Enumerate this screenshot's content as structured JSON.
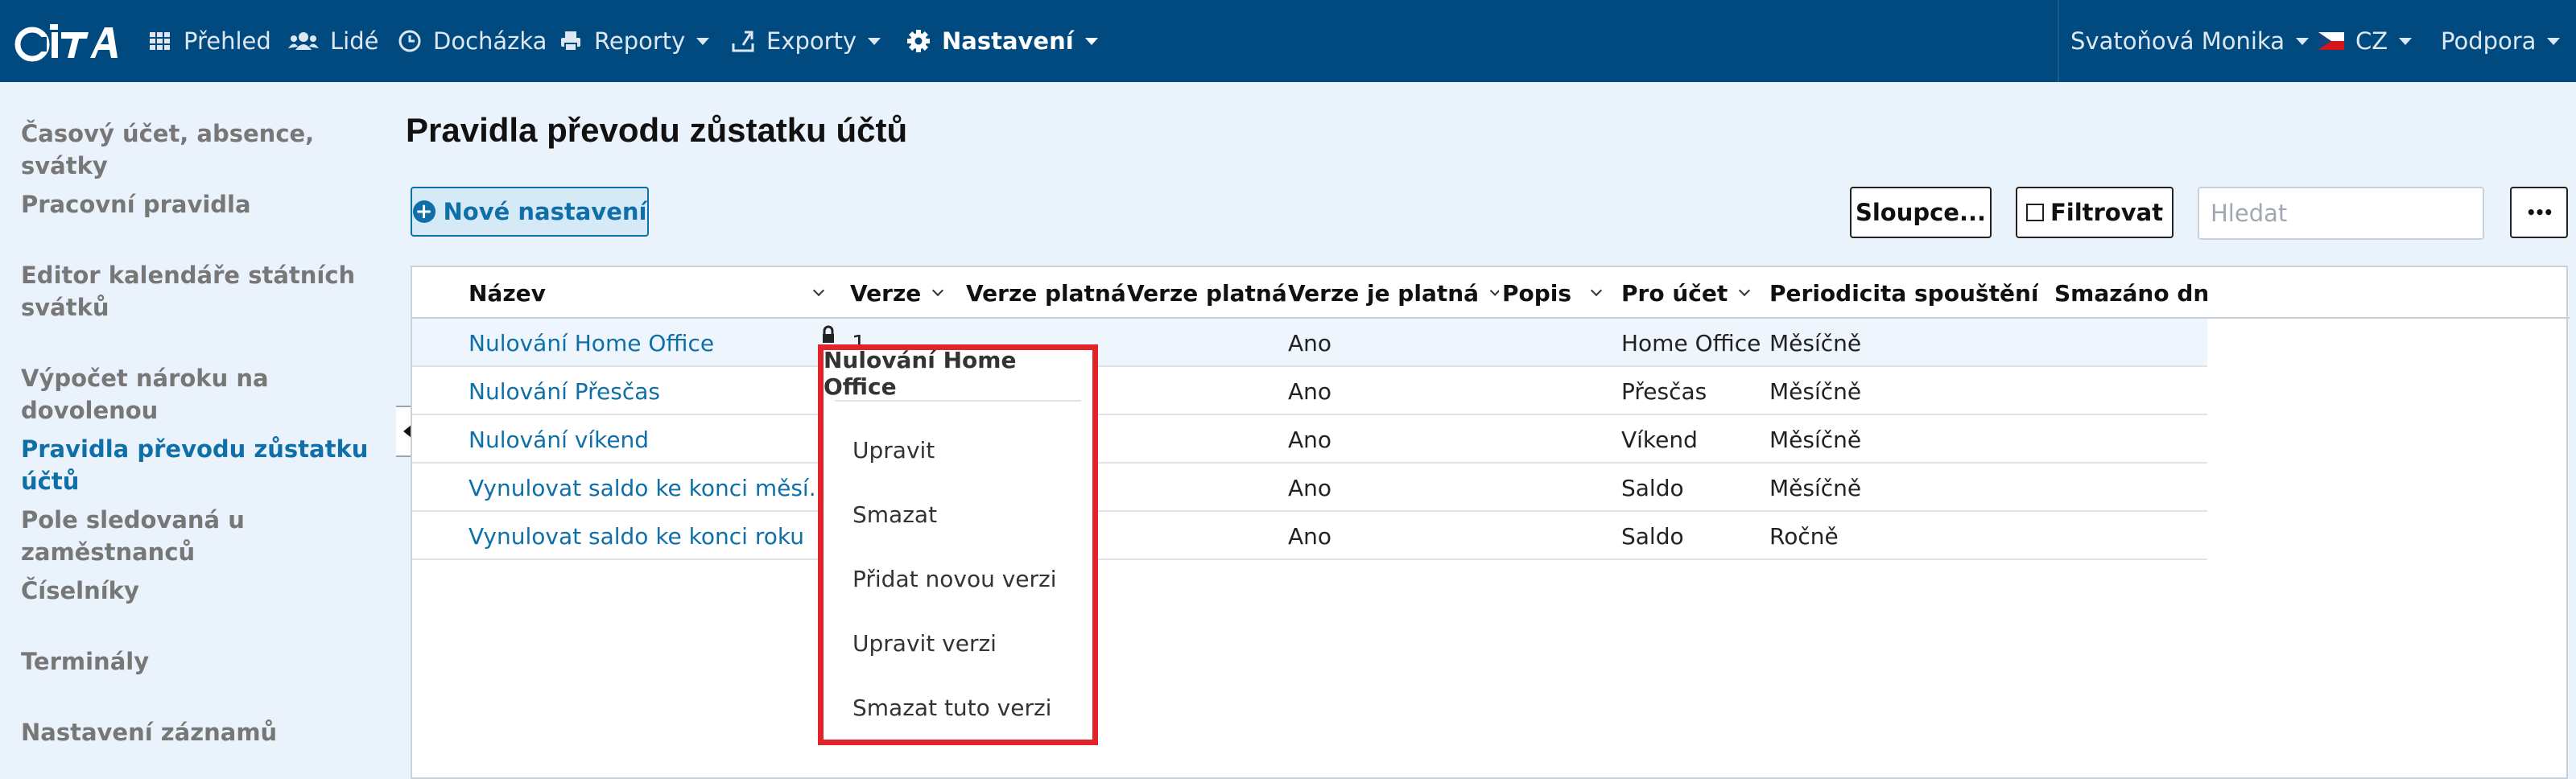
{
  "topbar": {
    "logo_text": "CiTA",
    "nav": [
      {
        "label": "Přehled",
        "icon": "grid-icon"
      },
      {
        "label": "Lidé",
        "icon": "users-icon"
      },
      {
        "label": "Docházka",
        "icon": "clock-icon"
      },
      {
        "label": "Reporty",
        "icon": "printer-icon"
      },
      {
        "label": "Exporty",
        "icon": "export-icon"
      },
      {
        "label": "Nastavení",
        "icon": "gear-icon",
        "active": true
      }
    ],
    "user": "Svatoňová Monika",
    "language": "CZ",
    "support": "Podpora"
  },
  "sidebar": {
    "items": [
      {
        "label": "Časový účet, absence, svátky"
      },
      {
        "label": "Pracovní pravidla"
      },
      {
        "label": "Editor kalendáře státních svátků"
      },
      {
        "label": "Výpočet nároku na dovolenou"
      },
      {
        "label": "Pravidla převodu zůstatku účtů",
        "active": true
      },
      {
        "label": "Pole sledovaná u zaměstnanců"
      },
      {
        "label": "Číselníky"
      },
      {
        "label": "Terminály"
      },
      {
        "label": "Nastavení záznamů"
      }
    ]
  },
  "page": {
    "title": "Pravidla převodu zůstatku účtů",
    "new_button": "Nové nastavení",
    "columns_button": "Sloupce...",
    "filter_button": "Filtrovat",
    "search_placeholder": "Hledat",
    "more_button": "•••"
  },
  "table": {
    "headers": [
      "Název",
      "Verze",
      "Verze platná od",
      "Verze platná do",
      "Verze je platná",
      "Popis",
      "Pro účet",
      "Periodicita spouštění",
      "Smazáno dne"
    ],
    "rows": [
      {
        "name": "Nulování Home Office",
        "version": "1",
        "valid": "Ano",
        "account": "Home Office",
        "period": "Měsíčně"
      },
      {
        "name": "Nulování Přesčas",
        "version": "",
        "valid": "Ano",
        "account": "Přesčas",
        "period": "Měsíčně"
      },
      {
        "name": "Nulování víkend",
        "version": "",
        "valid": "Ano",
        "account": "Víkend",
        "period": "Měsíčně"
      },
      {
        "name": "Vynulovat saldo ke konci měsí...",
        "version": "",
        "valid": "Ano",
        "account": "Saldo",
        "period": "Měsíčně"
      },
      {
        "name": "Vynulovat saldo ke konci roku",
        "version": "",
        "valid": "Ano",
        "account": "Saldo",
        "period": "Ročně"
      }
    ]
  },
  "context_menu": {
    "title": "Nulování Home Office",
    "items": [
      "Upravit",
      "Smazat",
      "Přidat novou verzi",
      "Upravit verzi",
      "Smazat tuto verzi"
    ]
  },
  "colors": {
    "topbar": "#004a80",
    "accent": "#0f6fa8",
    "highlight_border": "#e0242a",
    "sidebar_bg": "#eaf3fb"
  }
}
